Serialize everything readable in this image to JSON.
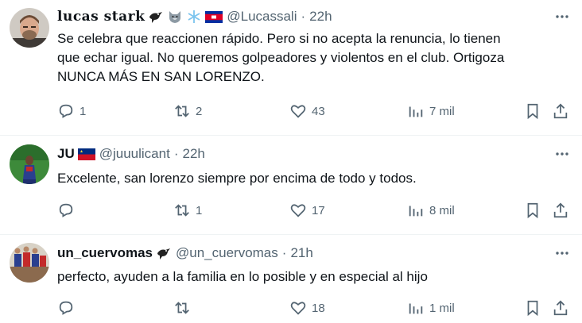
{
  "tweets": [
    {
      "display_name": "lucas stark",
      "emojis": [
        "crow-icon",
        "wolf-icon",
        "snowflake-icon",
        "cambodia-flag-icon"
      ],
      "handle": "@Lucassali",
      "dot": "·",
      "time": "22h",
      "text": "Se celebra que reaccionen rápido. Pero si no acepta la renuncia, lo tienen\nque echar igual. No queremos golpeadores y violentos en el club. Ortigoza\nNUNCA MÁS EN SAN LORENZO.",
      "replies": "1",
      "reposts": "2",
      "likes": "43",
      "views": "7 mil"
    },
    {
      "display_name": "JU",
      "emojis": [
        "liechtenstein-flag-icon"
      ],
      "handle": "@juuulicant",
      "dot": "·",
      "time": "22h",
      "text": "Excelente, san lorenzo siempre por encima de todo y todos.",
      "replies": "",
      "reposts": "1",
      "likes": "17",
      "views": "8 mil"
    },
    {
      "display_name": "un_cuervomas",
      "emojis": [
        "crow-icon"
      ],
      "handle": "@un_cuervomas",
      "dot": "·",
      "time": "21h",
      "text": "perfecto, ayuden a la familia en lo posible y en especial al hijo",
      "replies": "",
      "reposts": "",
      "likes": "18",
      "views": "1 mil"
    }
  ],
  "colors": {
    "text_primary": "#0f1419",
    "text_secondary": "#536471",
    "divider": "#eff3f4",
    "background": "#ffffff"
  }
}
